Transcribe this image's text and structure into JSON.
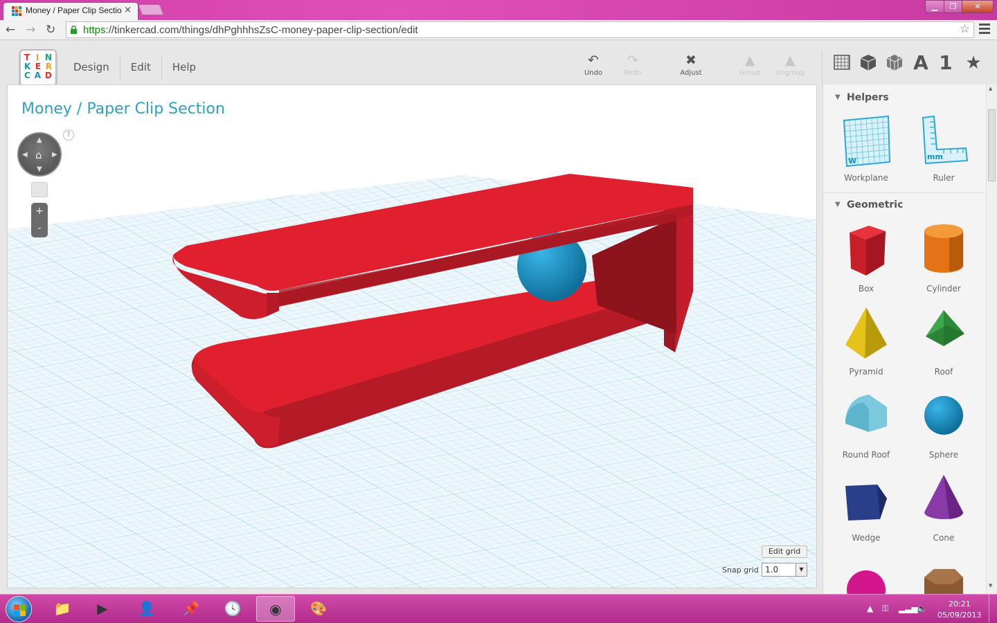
{
  "browser": {
    "tab_title": "Money / Paper Clip Sectio",
    "tab_close": "×",
    "url_secure": "https",
    "url_rest": "://tinkercad.com/things/dhPghhhsZsC-money-paper-clip-section/edit",
    "star": "☆"
  },
  "logo": {
    "row1": [
      "T",
      "I",
      "N"
    ],
    "row2": [
      "K",
      "E",
      "R"
    ],
    "row3": [
      "C",
      "A",
      "D"
    ]
  },
  "menu": [
    "Design",
    "Edit",
    "Help"
  ],
  "tools": [
    {
      "label": "Undo",
      "icon": "undo-icon",
      "enabled": true
    },
    {
      "label": "Redo",
      "icon": "redo-icon",
      "enabled": false
    },
    {
      "label": "Adjust",
      "icon": "adjust-icon",
      "enabled": true
    },
    {
      "label": "Group",
      "icon": "group-icon",
      "enabled": false
    },
    {
      "label": "Ungroup",
      "icon": "ungroup-icon",
      "enabled": false
    }
  ],
  "view_icons": {
    "text_icon": "A",
    "number_icon": "1",
    "favorite_icon": "★"
  },
  "design": {
    "title": "Money / Paper Clip Section"
  },
  "viewport_controls": {
    "help": "?",
    "zoom_in": "+",
    "zoom_out": "-"
  },
  "grid": {
    "edit_label": "Edit grid",
    "snap_label": "Snap grid",
    "snap_value": "1.0"
  },
  "panel": {
    "helpers_title": "Helpers",
    "helpers": [
      "Workplane",
      "Ruler"
    ],
    "geometric_title": "Geometric",
    "shapes": [
      "Box",
      "Cylinder",
      "Pyramid",
      "Roof",
      "Round Roof",
      "Sphere",
      "Wedge",
      "Cone"
    ]
  },
  "taskbar": {
    "time": "20:21",
    "date": "05/09/2013"
  },
  "colors": {
    "title_teal": "#30a0c0",
    "clip_red": "#e0202e",
    "sphere_blue": "#1a8fc0",
    "chrome_pink": "#d23ea9"
  }
}
